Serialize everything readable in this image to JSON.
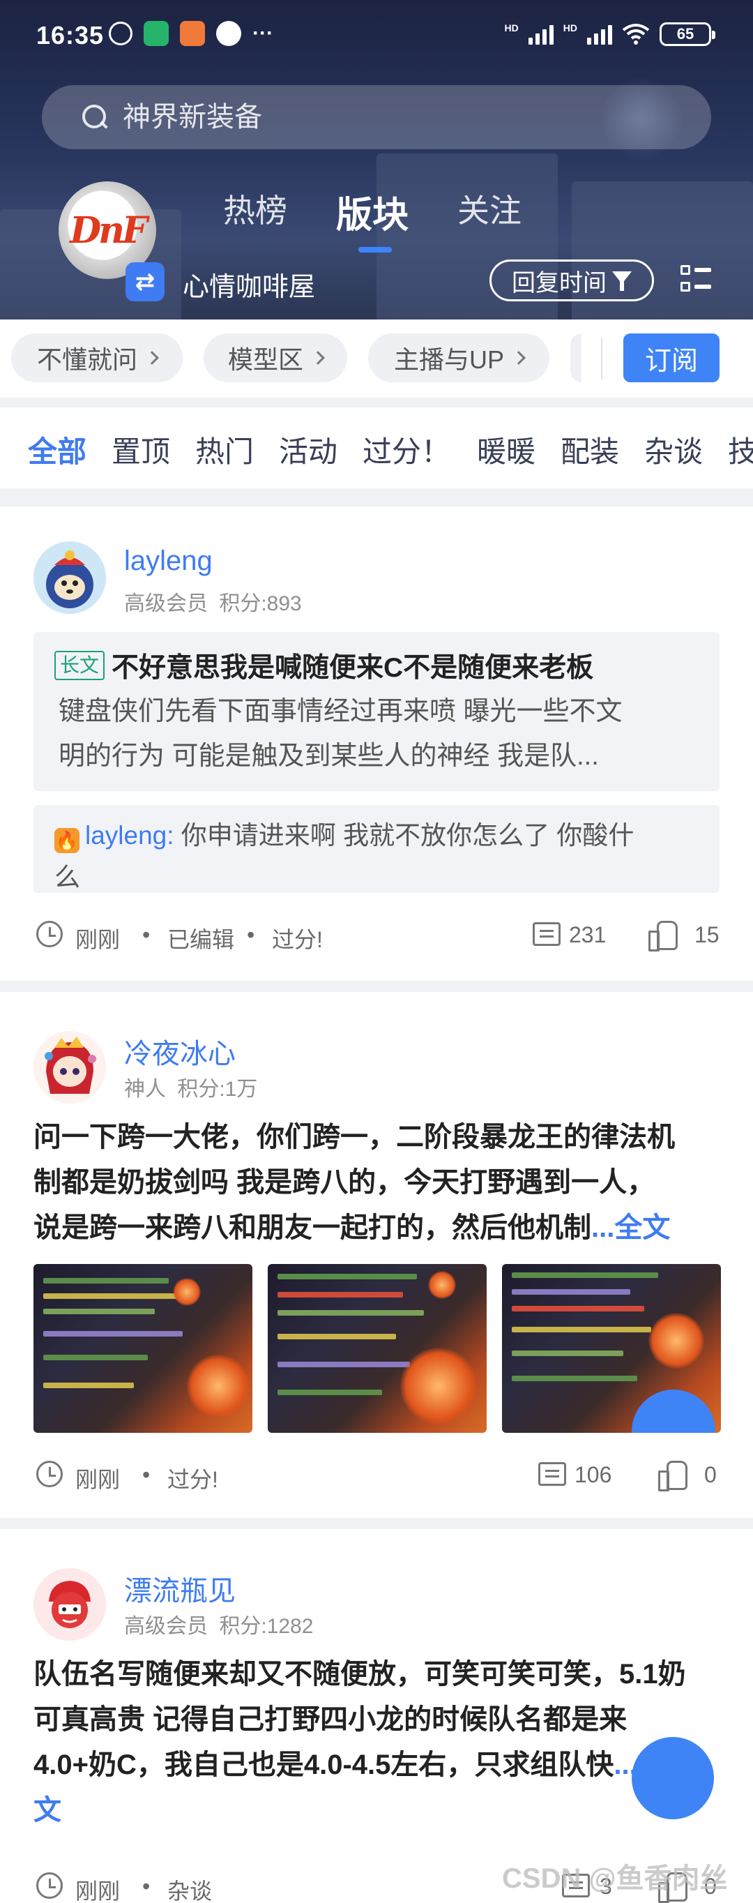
{
  "status_bar": {
    "time": "16:35",
    "battery": "65",
    "net_1": "HD",
    "net_2": "HD",
    "more": "···"
  },
  "search": {
    "placeholder": "神界新装备"
  },
  "community": {
    "name": "心情咖啡屋",
    "logo_text": "DnF"
  },
  "top_tabs": [
    {
      "label": "热榜",
      "active": false
    },
    {
      "label": "版块",
      "active": true
    },
    {
      "label": "关注",
      "active": false
    }
  ],
  "sort_button": {
    "label": "回复时间"
  },
  "sub_forums": [
    {
      "label": "不懂就问"
    },
    {
      "label": "模型区"
    },
    {
      "label": "主播与UP"
    }
  ],
  "subscribe_label": "订阅",
  "categories": [
    "全部",
    "置顶",
    "热门",
    "活动",
    "过分！",
    "暖暖",
    "配装",
    "杂谈",
    "技"
  ],
  "posts": [
    {
      "username": "layleng",
      "level": "高级会员",
      "points": "积分:893",
      "long_tag": "长文",
      "title": "不好意思我是喊随便来C不是随便来老板",
      "excerpt_line1": "键盘侠们先看下面事情经过再来喷  曝光一些不文",
      "excerpt_line2": "明的行为     可能是触及到某些人的神经  我是队...",
      "reply_user": "layleng:",
      "reply_text_line1": " 你申请进来啊  我就不放你怎么了 你酸什",
      "reply_text_line2": "么",
      "time": "刚刚",
      "edited": "已编辑",
      "category": "过分!",
      "comments": "231",
      "likes": "15"
    },
    {
      "username": "冷夜冰心",
      "level": "神人",
      "points": "积分:1万",
      "title_line1": "问一下跨一大佬，你们跨一，二阶段暴龙王的律法机",
      "title_line2": "制都是奶拔剑吗     我是跨八的，今天打野遇到一人，",
      "title_line3": "说是跨一来跨八和朋友一起打的，然后他机制",
      "more": "...全文",
      "time": "刚刚",
      "category": "过分!",
      "comments": "106",
      "likes": "0"
    },
    {
      "username": "漂流瓶见",
      "level": "高级会员",
      "points": "积分:1282",
      "title_line1": "队伍名写随便来却又不随便放，可笑可笑可笑，5.1奶",
      "title_line2": "可真高贵     记得自己打野四小龙的时候队名都是来",
      "title_line3": "4.0+奶C，我自己也是4.0-4.5左右，只求组队快",
      "more": "...全",
      "more_2": "文",
      "time": "刚刚",
      "category": "杂谈",
      "comments": "3",
      "likes": "0"
    }
  ],
  "watermark": "CSDN @鱼香肉丝er",
  "colors": {
    "accent": "#3f7bf2",
    "header_bg": "#27345c",
    "page_bg": "#f1f2f5",
    "long_tag": "#1aa27a"
  },
  "icons": [
    "search-icon",
    "switch-icon",
    "filter-icon",
    "list-view-icon",
    "chevron-right-icon",
    "clock-icon",
    "comment-icon",
    "like-icon",
    "fire-icon"
  ]
}
